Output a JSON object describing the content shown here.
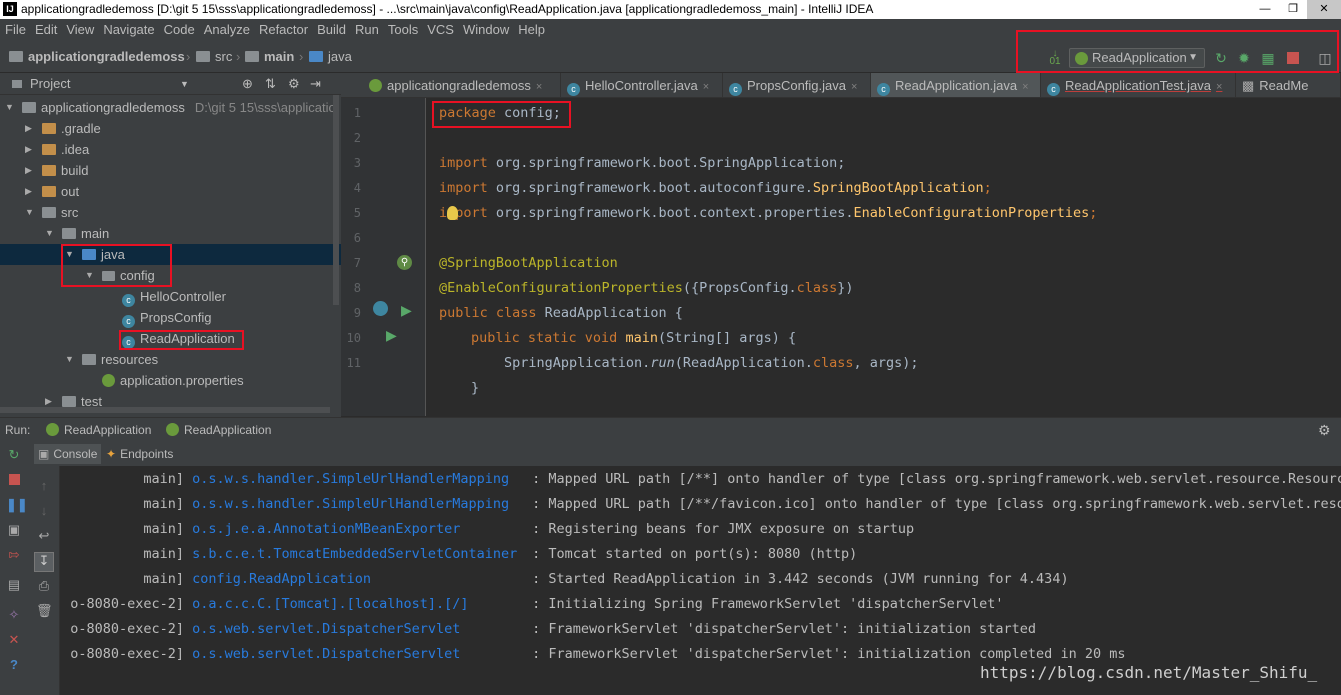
{
  "window": {
    "title": "applicationgradledemoss [D:\\git 5 15\\sss\\applicationgradledemoss] - ...\\src\\main\\java\\config\\ReadApplication.java [applicationgradledemoss_main] - IntelliJ IDEA",
    "app_icon_text": "IJ"
  },
  "menu": [
    "File",
    "Edit",
    "View",
    "Navigate",
    "Code",
    "Analyze",
    "Refactor",
    "Build",
    "Run",
    "Tools",
    "VCS",
    "Window",
    "Help"
  ],
  "breadcrumb": [
    "applicationgradledemoss",
    "src",
    "main",
    "java"
  ],
  "toolbar": {
    "run_config": "ReadApplication"
  },
  "project_panel": {
    "header": "Project",
    "root_name": "applicationgradledemoss",
    "root_path": "D:\\git 5 15\\sss\\applicatio",
    "tree": [
      {
        "label": ".gradle"
      },
      {
        "label": ".idea"
      },
      {
        "label": "build"
      },
      {
        "label": "out"
      },
      {
        "label": "src"
      },
      {
        "label": "main"
      },
      {
        "label": "java"
      },
      {
        "label": "config"
      },
      {
        "label": "HelloController"
      },
      {
        "label": "PropsConfig"
      },
      {
        "label": "ReadApplication"
      },
      {
        "label": "resources"
      },
      {
        "label": "application.properties"
      },
      {
        "label": "test"
      }
    ]
  },
  "editor_tabs": [
    "applicationgradledemoss",
    "HelloController.java",
    "PropsConfig.java",
    "ReadApplication.java",
    "ReadApplicationTest.java",
    "ReadMe"
  ],
  "code": {
    "line_numbers": [
      "1",
      "2",
      "3",
      "4",
      "5",
      "6",
      "7",
      "8",
      "9",
      "10",
      "11"
    ],
    "l1_kw": "package",
    "l1_rest": " config;",
    "l3_kw": "import",
    "l3_rest": " org.springframework.boot.SpringApplication;",
    "l4_kw": "import",
    "l4_pkg": " org.springframework.boot.autoconfigure.",
    "l4_cls": "SpringBootApplication",
    "l4_end": ";",
    "l5_kw": "import",
    "l5_pkg": " org.springframework.boot.context.properties.",
    "l5_cls": "EnableConfigurationProperties",
    "l5_end": ";",
    "l7": "@SpringBootApplication",
    "l8_ann": "@EnableConfigurationProperties",
    "l8_a": "({PropsConfig.",
    "l8_kw": "class",
    "l8_b": "})",
    "l9_kw": "public class",
    "l9_rest": " ReadApplication {",
    "l10_kw": "public static void",
    "l10_m": " main",
    "l10_rest": "(String[] args) {",
    "l11_a": "SpringApplication.",
    "l11_run": "run",
    "l11_b": "(ReadApplication.",
    "l11_kw": "class",
    "l11_c": ", args);",
    "l12": "}"
  },
  "run_panel": {
    "label": "Run:",
    "tabs": [
      "ReadApplication",
      "ReadApplication"
    ],
    "sub_tabs": [
      "Console",
      "Endpoints"
    ]
  },
  "console": [
    {
      "thread": "main]",
      "logger": "o.s.w.s.handler.SimpleUrlHandlerMapping",
      "msg": ": Mapped URL path [/**] onto handler of type [class org.springframework.web.servlet.resource.ResourceHt"
    },
    {
      "thread": "main]",
      "logger": "o.s.w.s.handler.SimpleUrlHandlerMapping",
      "msg": ": Mapped URL path [/**/favicon.ico] onto handler of type [class org.springframework.web.servlet.resourc"
    },
    {
      "thread": "main]",
      "logger": "o.s.j.e.a.AnnotationMBeanExporter",
      "msg": ": Registering beans for JMX exposure on startup"
    },
    {
      "thread": "main]",
      "logger": "s.b.c.e.t.TomcatEmbeddedServletContainer",
      "msg": ": Tomcat started on port(s): 8080 (http)"
    },
    {
      "thread": "main]",
      "logger": "config.ReadApplication",
      "msg": ": Started ReadApplication in 3.442 seconds (JVM running for 4.434)"
    },
    {
      "thread": "o-8080-exec-2]",
      "logger": "o.a.c.c.C.[Tomcat].[localhost].[/]",
      "msg": ": Initializing Spring FrameworkServlet 'dispatcherServlet'"
    },
    {
      "thread": "o-8080-exec-2]",
      "logger": "o.s.web.servlet.DispatcherServlet",
      "msg": ": FrameworkServlet 'dispatcherServlet': initialization started"
    },
    {
      "thread": "o-8080-exec-2]",
      "logger": "o.s.web.servlet.DispatcherServlet",
      "msg": ": FrameworkServlet 'dispatcherServlet': initialization completed in 20 ms"
    }
  ],
  "watermark": "https://blog.csdn.net/Master_Shifu_",
  "colors": {
    "highlight_box": "#e81123",
    "selection": "#0d293e",
    "keyword": "#cc7832",
    "annotation": "#bbb529",
    "logger": "#287bde"
  }
}
